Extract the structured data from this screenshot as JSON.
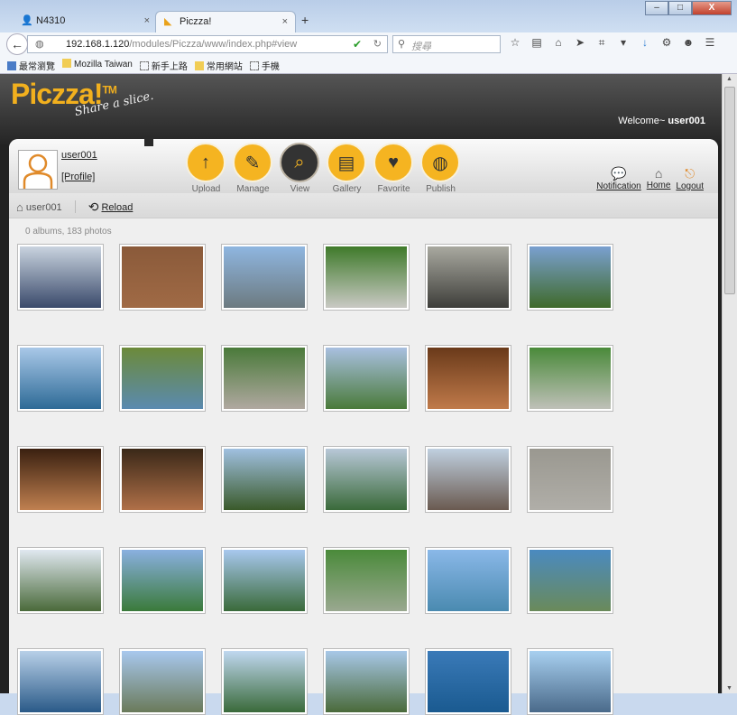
{
  "browser": {
    "tabs": [
      {
        "label": "N4310",
        "close": "×"
      },
      {
        "label": "Piczza!",
        "close": "×"
      }
    ],
    "new_tab": "+",
    "url_host": "192.168.1.120",
    "url_path": "/modules/Piczza/www/index.php#view",
    "search_placeholder": "搜尋",
    "bookmarks": [
      "最常瀏覽",
      "Mozilla Taiwan",
      "新手上路",
      "常用網站",
      "手機"
    ],
    "window_buttons": [
      "–",
      "□",
      "X"
    ]
  },
  "app": {
    "logo": "Piczza!",
    "logo_tm": "TM",
    "slogan": "Share a slice.",
    "welcome_prefix": "Welcome~ ",
    "welcome_user": "user001",
    "username": "user001",
    "profile_link": "[Profile]",
    "nav": [
      {
        "label": "Upload",
        "icon": "↑"
      },
      {
        "label": "Manage",
        "icon": "✎"
      },
      {
        "label": "View",
        "icon": "⌕"
      },
      {
        "label": "Gallery",
        "icon": "▤"
      },
      {
        "label": "Favorite",
        "icon": "♥"
      },
      {
        "label": "Publish",
        "icon": "◍"
      }
    ],
    "active_nav": "View",
    "right_links": [
      {
        "label": "Notification",
        "icon": "💬"
      },
      {
        "label": "Home",
        "icon": "⌂"
      },
      {
        "label": "Logout",
        "icon": "⎋"
      }
    ],
    "breadcrumb_user": "user001",
    "reload": "Reload",
    "count": "0 albums, 183 photos",
    "accent": "#f5b421"
  },
  "photos": [
    [
      "#c9d3df",
      "#3a4a6b"
    ],
    [
      "#8a5a3a",
      "#a06a45"
    ],
    [
      "#8fb6e0",
      "#6c7a80"
    ],
    [
      "#3f7a2a",
      "#c9c9c4"
    ],
    [
      "#a9a9a0",
      "#3e3e3a"
    ],
    [
      "#7aa0d0",
      "#3f6a2a"
    ],
    [
      "#a9c8e8",
      "#2d6a96"
    ],
    [
      "#6c8a3a",
      "#5a8ab0"
    ],
    [
      "#4a7a3a",
      "#b0a8a0"
    ],
    [
      "#a9c0e0",
      "#4a7a3a"
    ],
    [
      "#6a3a1a",
      "#c07a4a"
    ],
    [
      "#4a8a3a",
      "#bfc0b8"
    ],
    [
      "#3a2010",
      "#c08050"
    ],
    [
      "#3a2818",
      "#b07048"
    ],
    [
      "#a0c0e0",
      "#3a5a2a"
    ],
    [
      "#b8c8d8",
      "#3a6a3a"
    ],
    [
      "#c0d0e0",
      "#6a5a50"
    ],
    [
      "#9a9890",
      "#b0aea8"
    ],
    [
      "#e0e8f0",
      "#4a6a3a"
    ],
    [
      "#8ab0e0",
      "#3a7a3a"
    ],
    [
      "#a8c8ee",
      "#3a6a3a"
    ],
    [
      "#4a8a3a",
      "#9aa890"
    ],
    [
      "#8ab8e8",
      "#4a8ab0"
    ],
    [
      "#4a8ac0",
      "#6a8a5a"
    ],
    [
      "#b8d0e8",
      "#2a5a88"
    ],
    [
      "#a8c8ee",
      "#6a7a5a"
    ],
    [
      "#c0d8f0",
      "#3a6a3a"
    ],
    [
      "#a8c8e8",
      "#4a6a3a"
    ],
    [
      "#3a7ab8",
      "#1a5a90"
    ],
    [
      "#a8d0f0",
      "#4a6a8a"
    ]
  ]
}
